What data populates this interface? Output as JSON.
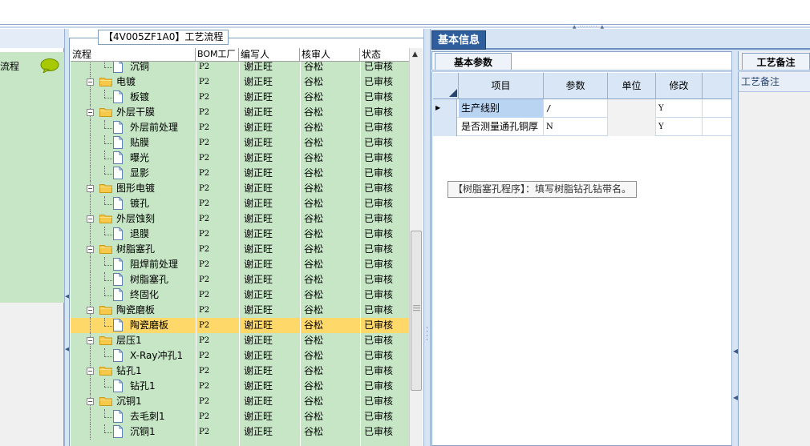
{
  "left": {
    "title": "流程"
  },
  "tree": {
    "group_title": "【4V005ZF1A0】工艺流程",
    "headers": {
      "name": "流程",
      "bom": "BOM工厂",
      "writer": "编写人",
      "checker": "核审人",
      "status": "状态"
    },
    "rows": [
      {
        "label": "沉铜",
        "level": 2,
        "bom": "P2",
        "writer": "谢正旺",
        "checker": "谷松",
        "status": "已审核"
      },
      {
        "label": "电镀",
        "level": 1,
        "bom": "P2",
        "writer": "谢正旺",
        "checker": "谷松",
        "status": "已审核"
      },
      {
        "label": "板镀",
        "level": 2,
        "bom": "P2",
        "writer": "谢正旺",
        "checker": "谷松",
        "status": "已审核"
      },
      {
        "label": "外层干膜",
        "level": 1,
        "bom": "P2",
        "writer": "谢正旺",
        "checker": "谷松",
        "status": "已审核"
      },
      {
        "label": "外层前处理",
        "level": 2,
        "bom": "P2",
        "writer": "谢正旺",
        "checker": "谷松",
        "status": "已审核"
      },
      {
        "label": "贴膜",
        "level": 2,
        "bom": "P2",
        "writer": "谢正旺",
        "checker": "谷松",
        "status": "已审核"
      },
      {
        "label": "曝光",
        "level": 2,
        "bom": "P2",
        "writer": "谢正旺",
        "checker": "谷松",
        "status": "已审核"
      },
      {
        "label": "显影",
        "level": 2,
        "bom": "P2",
        "writer": "谢正旺",
        "checker": "谷松",
        "status": "已审核"
      },
      {
        "label": "图形电镀",
        "level": 1,
        "bom": "P2",
        "writer": "谢正旺",
        "checker": "谷松",
        "status": "已审核"
      },
      {
        "label": "镀孔",
        "level": 2,
        "bom": "P2",
        "writer": "谢正旺",
        "checker": "谷松",
        "status": "已审核"
      },
      {
        "label": "外层蚀刻",
        "level": 1,
        "bom": "P2",
        "writer": "谢正旺",
        "checker": "谷松",
        "status": "已审核"
      },
      {
        "label": "退膜",
        "level": 2,
        "bom": "P2",
        "writer": "谢正旺",
        "checker": "谷松",
        "status": "已审核"
      },
      {
        "label": "树脂塞孔",
        "level": 1,
        "bom": "P2",
        "writer": "谢正旺",
        "checker": "谷松",
        "status": "已审核"
      },
      {
        "label": "阻焊前处理",
        "level": 2,
        "bom": "P2",
        "writer": "谢正旺",
        "checker": "谷松",
        "status": "已审核"
      },
      {
        "label": "树脂塞孔",
        "level": 2,
        "bom": "P2",
        "writer": "谢正旺",
        "checker": "谷松",
        "status": "已审核"
      },
      {
        "label": "终固化",
        "level": 2,
        "bom": "P2",
        "writer": "谢正旺",
        "checker": "谷松",
        "status": "已审核"
      },
      {
        "label": "陶瓷磨板",
        "level": 1,
        "bom": "P2",
        "writer": "谢正旺",
        "checker": "谷松",
        "status": "已审核"
      },
      {
        "label": "陶瓷磨板",
        "level": 2,
        "bom": "P2",
        "writer": "谢正旺",
        "checker": "谷松",
        "status": "已审核",
        "selected": true
      },
      {
        "label": "层压1",
        "level": 1,
        "bom": "P2",
        "writer": "谢正旺",
        "checker": "谷松",
        "status": "已审核"
      },
      {
        "label": "X-Ray冲孔1",
        "level": 2,
        "bom": "P2",
        "writer": "谢正旺",
        "checker": "谷松",
        "status": "已审核"
      },
      {
        "label": "钻孔1",
        "level": 1,
        "bom": "P2",
        "writer": "谢正旺",
        "checker": "谷松",
        "status": "已审核"
      },
      {
        "label": "钻孔1",
        "level": 2,
        "bom": "P2",
        "writer": "谢正旺",
        "checker": "谷松",
        "status": "已审核"
      },
      {
        "label": "沉铜1",
        "level": 1,
        "bom": "P2",
        "writer": "谢正旺",
        "checker": "谷松",
        "status": "已审核"
      },
      {
        "label": "去毛刺1",
        "level": 2,
        "bom": "P2",
        "writer": "谢正旺",
        "checker": "谷松",
        "status": "已审核"
      },
      {
        "label": "沉铜1",
        "level": 2,
        "bom": "P2",
        "writer": "谢正旺",
        "checker": "谷松",
        "status": "已审核"
      }
    ]
  },
  "right": {
    "tab_basic_info": "基本信息",
    "subtab_basic_params": "基本参数",
    "grid_headers": {
      "item": "项目",
      "param": "参数",
      "unit": "单位",
      "modify": "修改"
    },
    "grid_rows": [
      {
        "item": "生产线别",
        "param": "/",
        "unit": "",
        "modify": "Y"
      },
      {
        "item": "是否测量通孔铜厚",
        "param": "N",
        "unit": "",
        "modify": "Y"
      }
    ],
    "hint": "【树脂塞孔程序】：填写树脂钻孔钻带名。",
    "remark_tab": "工艺备注",
    "remark_label": "工艺备注"
  }
}
